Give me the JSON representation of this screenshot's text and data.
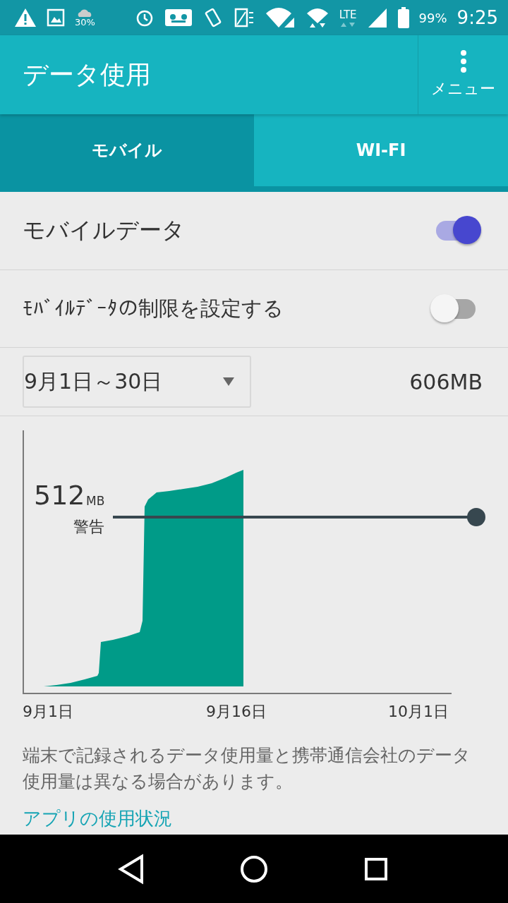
{
  "status_bar": {
    "weather": "30%",
    "network": "LTE",
    "battery": "99%",
    "time": "9:25"
  },
  "toolbar": {
    "title": "データ使用",
    "menu_label": "メニュー"
  },
  "tabs": [
    {
      "label": "モバイル",
      "selected": true
    },
    {
      "label": "WI-FI",
      "selected": false
    }
  ],
  "settings": [
    {
      "label": "モバイルデータ",
      "on": true
    },
    {
      "label": "ﾓﾊﾞｲﾙﾃﾞｰﾀの制限を設定する",
      "on": false
    }
  ],
  "cycle": {
    "range": "9月1日～30日",
    "total": "606MB"
  },
  "chart": {
    "warning_value": "512",
    "warning_unit": "MB",
    "warning_label": "警告",
    "x_labels": [
      "9月1日",
      "9月16日",
      "10月1日"
    ]
  },
  "note": "端末で記録されるデータ使用量と携帯通信会社のデータ使用量は異なる場合があります。",
  "link": "アプリの使用状況"
}
